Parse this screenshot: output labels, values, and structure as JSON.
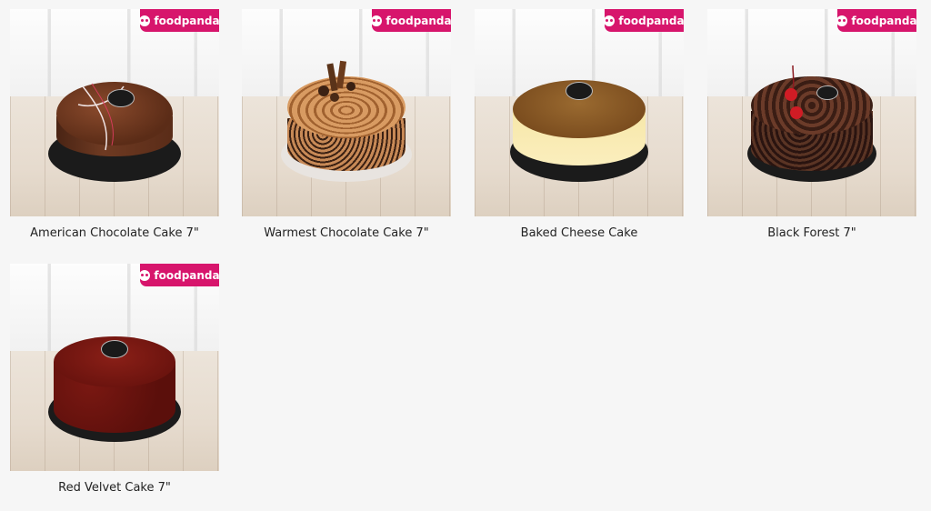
{
  "badge": {
    "label": "foodpanda"
  },
  "products": [
    {
      "name": "American Chocolate Cake 7\""
    },
    {
      "name": "Warmest Chocolate Cake 7\""
    },
    {
      "name": "Baked Cheese Cake"
    },
    {
      "name": "Black Forest 7\""
    },
    {
      "name": "Red Velvet Cake 7\""
    }
  ],
  "colors": {
    "badge": "#d7156c",
    "page_bg": "#f6f6f6",
    "text": "#222222"
  }
}
